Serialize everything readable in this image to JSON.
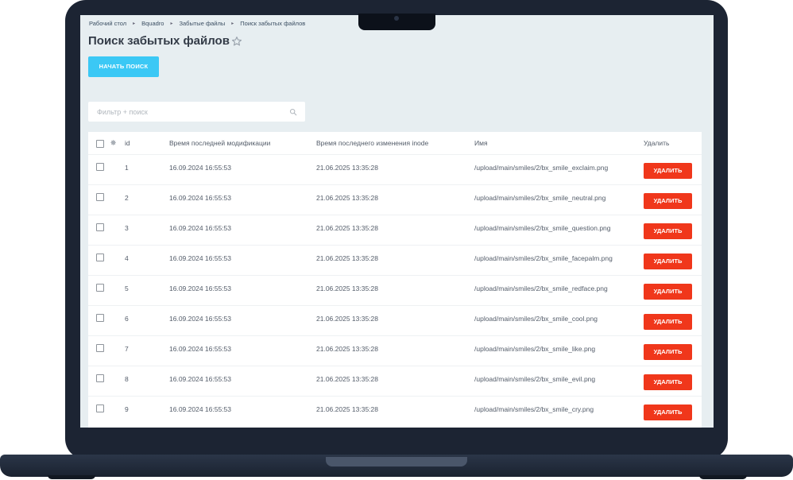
{
  "breadcrumb": [
    "Рабочий стол",
    "Bquadro",
    "Забытые файлы",
    "Поиск забытых файлов"
  ],
  "page_title": "Поиск забытых файлов",
  "start_button": "НАЧАТЬ ПОИСК",
  "filter": {
    "placeholder": "Фильтр + поиск"
  },
  "table": {
    "columns": {
      "id": "id",
      "mtime": "Время последней модификации",
      "ctime": "Время последнего изменения inode",
      "name": "Имя",
      "delete": "Удалить"
    },
    "delete_label": "УДАЛИТЬ",
    "rows": [
      {
        "id": "1",
        "mtime": "16.09.2024 16:55:53",
        "ctime": "21.06.2025 13:35:28",
        "name": "/upload/main/smiles/2/bx_smile_exclaim.png"
      },
      {
        "id": "2",
        "mtime": "16.09.2024 16:55:53",
        "ctime": "21.06.2025 13:35:28",
        "name": "/upload/main/smiles/2/bx_smile_neutral.png"
      },
      {
        "id": "3",
        "mtime": "16.09.2024 16:55:53",
        "ctime": "21.06.2025 13:35:28",
        "name": "/upload/main/smiles/2/bx_smile_question.png"
      },
      {
        "id": "4",
        "mtime": "16.09.2024 16:55:53",
        "ctime": "21.06.2025 13:35:28",
        "name": "/upload/main/smiles/2/bx_smile_facepalm.png"
      },
      {
        "id": "5",
        "mtime": "16.09.2024 16:55:53",
        "ctime": "21.06.2025 13:35:28",
        "name": "/upload/main/smiles/2/bx_smile_redface.png"
      },
      {
        "id": "6",
        "mtime": "16.09.2024 16:55:53",
        "ctime": "21.06.2025 13:35:28",
        "name": "/upload/main/smiles/2/bx_smile_cool.png"
      },
      {
        "id": "7",
        "mtime": "16.09.2024 16:55:53",
        "ctime": "21.06.2025 13:35:28",
        "name": "/upload/main/smiles/2/bx_smile_like.png"
      },
      {
        "id": "8",
        "mtime": "16.09.2024 16:55:53",
        "ctime": "21.06.2025 13:35:28",
        "name": "/upload/main/smiles/2/bx_smile_evil.png"
      },
      {
        "id": "9",
        "mtime": "16.09.2024 16:55:53",
        "ctime": "21.06.2025 13:35:28",
        "name": "/upload/main/smiles/2/bx_smile_cry.png"
      }
    ]
  },
  "colors": {
    "accent": "#3bc8f5",
    "danger": "#f0371b",
    "background": "#e7eef1"
  },
  "icons": [
    "star-icon",
    "search-icon",
    "gear-icon",
    "breadcrumb-chevron-icon"
  ]
}
